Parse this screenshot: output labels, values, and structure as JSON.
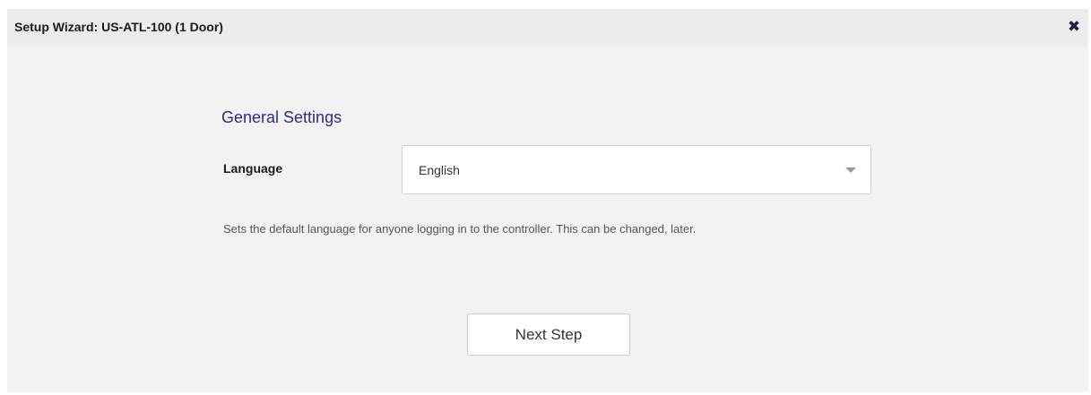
{
  "dialog": {
    "title": "Setup Wizard: US-ATL-100 (1 Door)",
    "close_icon": "close-icon"
  },
  "general_settings": {
    "heading": "General Settings",
    "language": {
      "label": "Language",
      "selected": "English",
      "caret_icon": "caret-down-icon"
    },
    "help_text": "Sets the default language for anyone logging in to the controller. This can be changed, later."
  },
  "actions": {
    "next_step_label": "Next Step"
  },
  "colors": {
    "heading": "#2b2f7a",
    "dialog_background": "#f2f2f2",
    "titlebar_background": "#ececec"
  }
}
